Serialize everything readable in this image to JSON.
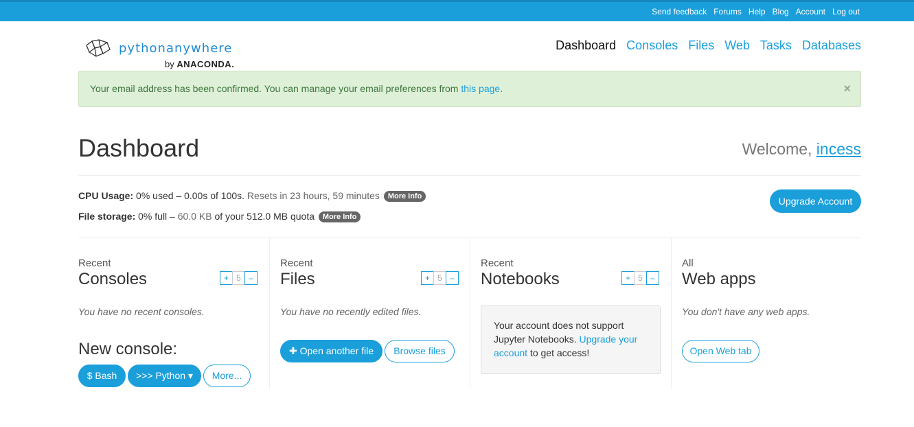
{
  "topbar": {
    "links": [
      "Send feedback",
      "Forums",
      "Help",
      "Blog",
      "Account",
      "Log out"
    ]
  },
  "logo": {
    "word1": "python",
    "word2": "anywhere",
    "by": "by",
    "brand": "ANACONDA."
  },
  "nav": [
    "Dashboard",
    "Consoles",
    "Files",
    "Web",
    "Tasks",
    "Databases"
  ],
  "alert": {
    "text": "Your email address has been confirmed. You can manage your email preferences from ",
    "link": "this page",
    "end": ".",
    "close": "×"
  },
  "page": {
    "title": "Dashboard",
    "welcome_prefix": "Welcome, ",
    "username": "incess"
  },
  "usage": {
    "cpu_label": "CPU Usage:",
    "cpu_value": " 0% used – 0.00s of 100s.",
    "cpu_reset": " Resets in 23 hours, 59 minutes",
    "storage_label": "File storage:",
    "storage_value": " 0% full – ",
    "storage_used": "60.0 KB",
    "storage_quota": " of your 512.0 MB quota",
    "more_info": "More Info",
    "upgrade": "Upgrade Account"
  },
  "stepper": {
    "plus": "+",
    "count": "5",
    "minus": "–"
  },
  "consoles": {
    "small": "Recent",
    "big": "Consoles",
    "empty": "You have no recent consoles.",
    "new_label": "New console:",
    "bash": "$ Bash",
    "python": ">>> Python ▾",
    "more": "More..."
  },
  "files": {
    "small": "Recent",
    "big": "Files",
    "empty": "You have no recently edited files.",
    "open": "✚ Open another file",
    "browse": "Browse files"
  },
  "notebooks": {
    "small": "Recent",
    "big": "Notebooks",
    "msg1": "Your account does not support Jupyter Notebooks. ",
    "link": "Upgrade your account",
    "msg2": " to get access!"
  },
  "webapps": {
    "small": "All",
    "big": "Web apps",
    "empty": "You don't have any web apps.",
    "open": "Open Web tab"
  }
}
